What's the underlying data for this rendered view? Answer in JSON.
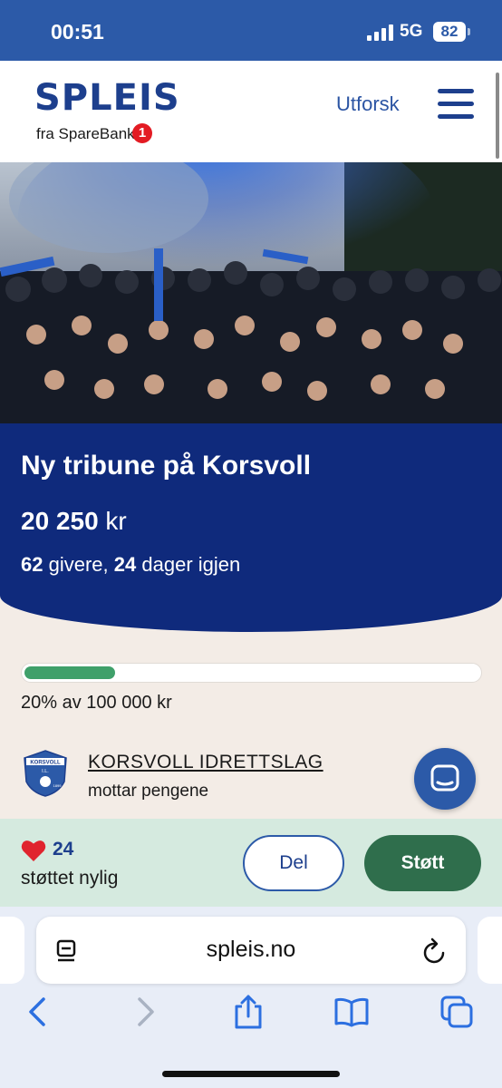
{
  "status_bar": {
    "time": "00:51",
    "network": "5G",
    "battery": "82"
  },
  "header": {
    "logo_text": "SPLEIS",
    "logo_sub": "fra SpareBank",
    "logo_badge": "1",
    "explore_label": "Utforsk",
    "menu_icon": "hamburger-icon"
  },
  "campaign": {
    "title": "Ny tribune på Korsvoll",
    "amount_value": "20 250",
    "amount_unit": "kr",
    "givers_count": "62",
    "givers_label": "givere,",
    "days_count": "24",
    "days_label": "dager igjen"
  },
  "progress": {
    "percent": 20,
    "text": "20% av 100 000 kr",
    "fill_color": "#3fa06a"
  },
  "organization": {
    "name": "KORSVOLL IDRETTSLAG",
    "subtitle": "mottar pengene",
    "logo_top": "KORSVOLL",
    "logo_bottom": "I.L.",
    "logo_year": "1899"
  },
  "support": {
    "count": "24",
    "label": "støttet nylig",
    "share_button": "Del",
    "support_button": "Støtt"
  },
  "browser": {
    "url": "spleis.no"
  },
  "colors": {
    "brand_blue": "#0f2a7c",
    "accent_blue": "#2c5aa8",
    "green": "#2f6e4c"
  }
}
